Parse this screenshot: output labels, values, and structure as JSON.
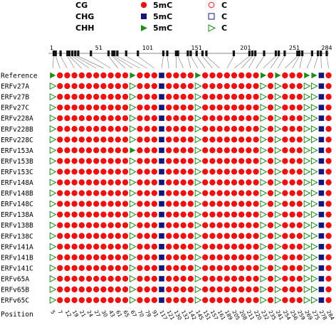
{
  "legend": {
    "contexts": [
      "CG",
      "CHG",
      "CHH"
    ],
    "methylated_label": "5mC",
    "unmethylated_label": "C"
  },
  "colors": {
    "CG": "#ee1111",
    "CHG": "#14147a",
    "CHH": "#1e8c1e"
  },
  "chart_data": {
    "type": "table",
    "title": "",
    "position_axis_label": "Position",
    "sequence_ticks": [
      1,
      51,
      101,
      151,
      201,
      251,
      284
    ],
    "positions": [
      5,
      7,
      12,
      19,
      21,
      24,
      27,
      30,
      43,
      61,
      65,
      67,
      70,
      79,
      91,
      117,
      121,
      130,
      132,
      142,
      145,
      151,
      157,
      161,
      189,
      205,
      208,
      211,
      220,
      232,
      235,
      241,
      254,
      256,
      259,
      269,
      275,
      278,
      284
    ],
    "contexts": [
      "CHH",
      "CG",
      "CG",
      "CG",
      "CG",
      "CG",
      "CG",
      "CG",
      "CG",
      "CG",
      "CG",
      "CHH",
      "CG",
      "CG",
      "CG",
      "CHG",
      "CG",
      "CG",
      "CG",
      "CG",
      "CHH",
      "CG",
      "CG",
      "CG",
      "CG",
      "CG",
      "CG",
      "CG",
      "CG",
      "CHH",
      "CG",
      "CHH",
      "CG",
      "CG",
      "CG",
      "CHH",
      "CHH",
      "CHG",
      "CG"
    ],
    "row_labels": [
      "Reference",
      "ERFv27A",
      "ERFv27B",
      "ERFv27C",
      "ERFv228A",
      "ERFv228B",
      "ERFv228C",
      "ERFv153A",
      "ERFv153B",
      "ERFv153C",
      "ERFv148A",
      "ERFv148B",
      "ERFv148C",
      "ERFv138A",
      "ERFv138B",
      "ERFv138C",
      "ERFv141A",
      "ERFv141B",
      "ERFv141C",
      "ERFv65A",
      "ERFv65B",
      "ERFv65C"
    ],
    "methylation": [
      [
        1,
        1,
        1,
        1,
        1,
        1,
        1,
        1,
        1,
        1,
        1,
        1,
        1,
        1,
        1,
        1,
        1,
        1,
        1,
        1,
        1,
        1,
        1,
        1,
        1,
        1,
        1,
        1,
        1,
        1,
        1,
        1,
        1,
        1,
        1,
        1,
        1,
        1,
        1
      ],
      [
        0,
        1,
        1,
        1,
        1,
        1,
        1,
        1,
        1,
        1,
        1,
        0,
        1,
        1,
        1,
        1,
        1,
        1,
        1,
        1,
        0,
        1,
        1,
        1,
        1,
        1,
        1,
        1,
        1,
        0,
        1,
        0,
        1,
        1,
        1,
        0,
        0,
        1,
        1
      ],
      [
        0,
        1,
        1,
        1,
        1,
        1,
        1,
        1,
        1,
        1,
        1,
        0,
        1,
        1,
        1,
        1,
        1,
        1,
        1,
        1,
        0,
        1,
        1,
        1,
        1,
        1,
        1,
        1,
        1,
        0,
        1,
        0,
        1,
        1,
        1,
        0,
        0,
        1,
        1
      ],
      [
        0,
        1,
        1,
        1,
        1,
        1,
        1,
        1,
        1,
        1,
        1,
        0,
        1,
        1,
        1,
        1,
        1,
        1,
        1,
        1,
        0,
        1,
        1,
        1,
        1,
        1,
        1,
        1,
        1,
        0,
        1,
        0,
        1,
        1,
        1,
        0,
        0,
        1,
        1
      ],
      [
        0,
        1,
        1,
        1,
        1,
        1,
        1,
        1,
        1,
        1,
        1,
        0,
        1,
        1,
        1,
        1,
        1,
        1,
        1,
        1,
        0,
        1,
        1,
        1,
        1,
        1,
        1,
        1,
        1,
        0,
        1,
        0,
        1,
        1,
        1,
        0,
        0,
        1,
        1
      ],
      [
        0,
        1,
        1,
        1,
        1,
        1,
        1,
        1,
        1,
        1,
        1,
        0,
        1,
        1,
        1,
        1,
        1,
        1,
        1,
        1,
        0,
        1,
        1,
        1,
        1,
        1,
        1,
        1,
        1,
        0,
        1,
        0,
        1,
        1,
        1,
        0,
        0,
        1,
        1
      ],
      [
        0,
        1,
        1,
        1,
        1,
        1,
        1,
        1,
        1,
        1,
        1,
        0,
        1,
        1,
        1,
        1,
        1,
        1,
        1,
        1,
        0,
        1,
        1,
        1,
        1,
        1,
        1,
        1,
        1,
        0,
        1,
        0,
        1,
        1,
        1,
        0,
        0,
        1,
        1
      ],
      [
        0,
        1,
        1,
        1,
        1,
        1,
        1,
        1,
        1,
        1,
        1,
        1,
        1,
        1,
        1,
        1,
        1,
        1,
        1,
        1,
        0,
        1,
        1,
        1,
        1,
        1,
        1,
        1,
        1,
        0,
        1,
        0,
        1,
        1,
        1,
        0,
        0,
        1,
        1
      ],
      [
        0,
        1,
        1,
        1,
        1,
        1,
        1,
        1,
        1,
        1,
        1,
        0,
        1,
        1,
        1,
        1,
        1,
        1,
        1,
        1,
        0,
        1,
        1,
        1,
        1,
        1,
        1,
        1,
        1,
        0,
        1,
        0,
        1,
        1,
        1,
        0,
        0,
        1,
        1
      ],
      [
        0,
        1,
        1,
        1,
        1,
        1,
        1,
        1,
        1,
        1,
        1,
        0,
        1,
        1,
        1,
        1,
        1,
        1,
        1,
        1,
        0,
        1,
        1,
        1,
        1,
        1,
        1,
        1,
        1,
        0,
        1,
        0,
        1,
        1,
        1,
        0,
        0,
        1,
        1
      ],
      [
        0,
        1,
        1,
        1,
        1,
        1,
        1,
        1,
        1,
        1,
        1,
        0,
        1,
        1,
        1,
        1,
        1,
        1,
        1,
        1,
        0,
        1,
        1,
        1,
        1,
        1,
        1,
        1,
        1,
        0,
        1,
        0,
        1,
        1,
        1,
        0,
        0,
        1,
        1
      ],
      [
        0,
        1,
        1,
        1,
        1,
        1,
        1,
        1,
        1,
        1,
        1,
        0,
        1,
        1,
        1,
        1,
        1,
        1,
        1,
        1,
        0,
        1,
        1,
        1,
        1,
        1,
        1,
        1,
        1,
        0,
        1,
        0,
        1,
        1,
        1,
        0,
        0,
        1,
        1
      ],
      [
        0,
        1,
        1,
        1,
        1,
        1,
        1,
        1,
        1,
        1,
        1,
        0,
        1,
        1,
        1,
        1,
        1,
        1,
        1,
        1,
        0,
        1,
        1,
        1,
        1,
        1,
        1,
        1,
        1,
        0,
        1,
        0,
        1,
        1,
        1,
        0,
        0,
        1,
        1
      ],
      [
        0,
        1,
        1,
        1,
        1,
        1,
        1,
        1,
        1,
        1,
        1,
        0,
        1,
        1,
        1,
        1,
        1,
        1,
        1,
        1,
        0,
        1,
        1,
        1,
        1,
        1,
        1,
        1,
        1,
        0,
        1,
        0,
        1,
        1,
        1,
        0,
        0,
        1,
        1
      ],
      [
        0,
        1,
        1,
        1,
        1,
        1,
        1,
        1,
        1,
        1,
        1,
        0,
        1,
        1,
        1,
        1,
        1,
        1,
        1,
        1,
        0,
        1,
        1,
        1,
        1,
        1,
        1,
        1,
        1,
        0,
        1,
        0,
        1,
        1,
        1,
        0,
        0,
        1,
        1
      ],
      [
        0,
        1,
        1,
        1,
        1,
        1,
        1,
        1,
        1,
        1,
        1,
        0,
        1,
        1,
        1,
        1,
        1,
        1,
        1,
        1,
        0,
        1,
        1,
        1,
        1,
        1,
        1,
        1,
        1,
        0,
        1,
        0,
        1,
        1,
        1,
        0,
        0,
        1,
        1
      ],
      [
        0,
        1,
        1,
        1,
        1,
        1,
        1,
        1,
        1,
        1,
        1,
        0,
        1,
        1,
        1,
        1,
        1,
        1,
        1,
        1,
        0,
        1,
        1,
        1,
        1,
        1,
        1,
        1,
        1,
        0,
        1,
        0,
        1,
        1,
        1,
        0,
        0,
        1,
        1
      ],
      [
        0,
        1,
        1,
        1,
        1,
        1,
        1,
        1,
        1,
        1,
        1,
        0,
        1,
        1,
        1,
        1,
        1,
        1,
        1,
        1,
        0,
        1,
        1,
        1,
        1,
        1,
        1,
        1,
        1,
        0,
        1,
        0,
        1,
        1,
        1,
        0,
        0,
        1,
        1
      ],
      [
        0,
        1,
        1,
        1,
        1,
        1,
        1,
        1,
        1,
        1,
        1,
        0,
        1,
        1,
        1,
        1,
        1,
        1,
        1,
        1,
        0,
        1,
        1,
        1,
        1,
        1,
        1,
        1,
        1,
        0,
        1,
        0,
        1,
        1,
        1,
        0,
        0,
        1,
        1
      ],
      [
        0,
        1,
        1,
        1,
        1,
        1,
        1,
        1,
        1,
        1,
        1,
        0,
        1,
        1,
        1,
        1,
        1,
        1,
        1,
        1,
        0,
        1,
        1,
        1,
        1,
        1,
        1,
        1,
        1,
        0,
        1,
        0,
        1,
        1,
        1,
        0,
        0,
        1,
        1
      ],
      [
        0,
        1,
        1,
        1,
        1,
        1,
        1,
        1,
        1,
        1,
        1,
        0,
        1,
        1,
        1,
        1,
        1,
        1,
        1,
        1,
        0,
        1,
        1,
        1,
        1,
        1,
        1,
        1,
        1,
        0,
        1,
        0,
        1,
        1,
        1,
        0,
        0,
        1,
        1
      ],
      [
        0,
        1,
        1,
        1,
        1,
        1,
        1,
        1,
        1,
        1,
        1,
        0,
        1,
        1,
        1,
        1,
        1,
        1,
        1,
        1,
        0,
        1,
        1,
        1,
        1,
        1,
        1,
        1,
        1,
        0,
        1,
        0,
        1,
        1,
        1,
        0,
        0,
        1,
        1
      ]
    ]
  }
}
